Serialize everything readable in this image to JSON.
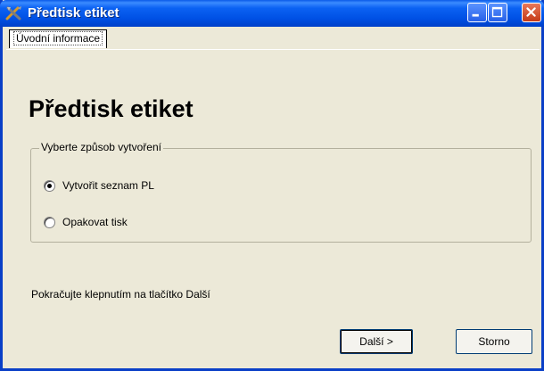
{
  "window": {
    "title": "Předtisk etiket",
    "icon": "tools-icon",
    "controls": [
      "minimize",
      "maximize",
      "close"
    ]
  },
  "tabs": [
    {
      "label": "Úvodní informace",
      "active": true
    }
  ],
  "page": {
    "heading": "Předtisk etiket",
    "group_label": "Vyberte způsob vytvoření",
    "options": [
      {
        "label": "Vytvořit seznam PL",
        "checked": true
      },
      {
        "label": "Opakovat tisk",
        "checked": false
      }
    ],
    "hint": "Pokračujte klepnutím na tlačítko Další"
  },
  "buttons": {
    "next_label": "Další >",
    "cancel_label": "Storno"
  },
  "colors": {
    "titlebar": "#0b62f3",
    "window_bg": "#ece9d8",
    "close_button": "#c53a17"
  }
}
